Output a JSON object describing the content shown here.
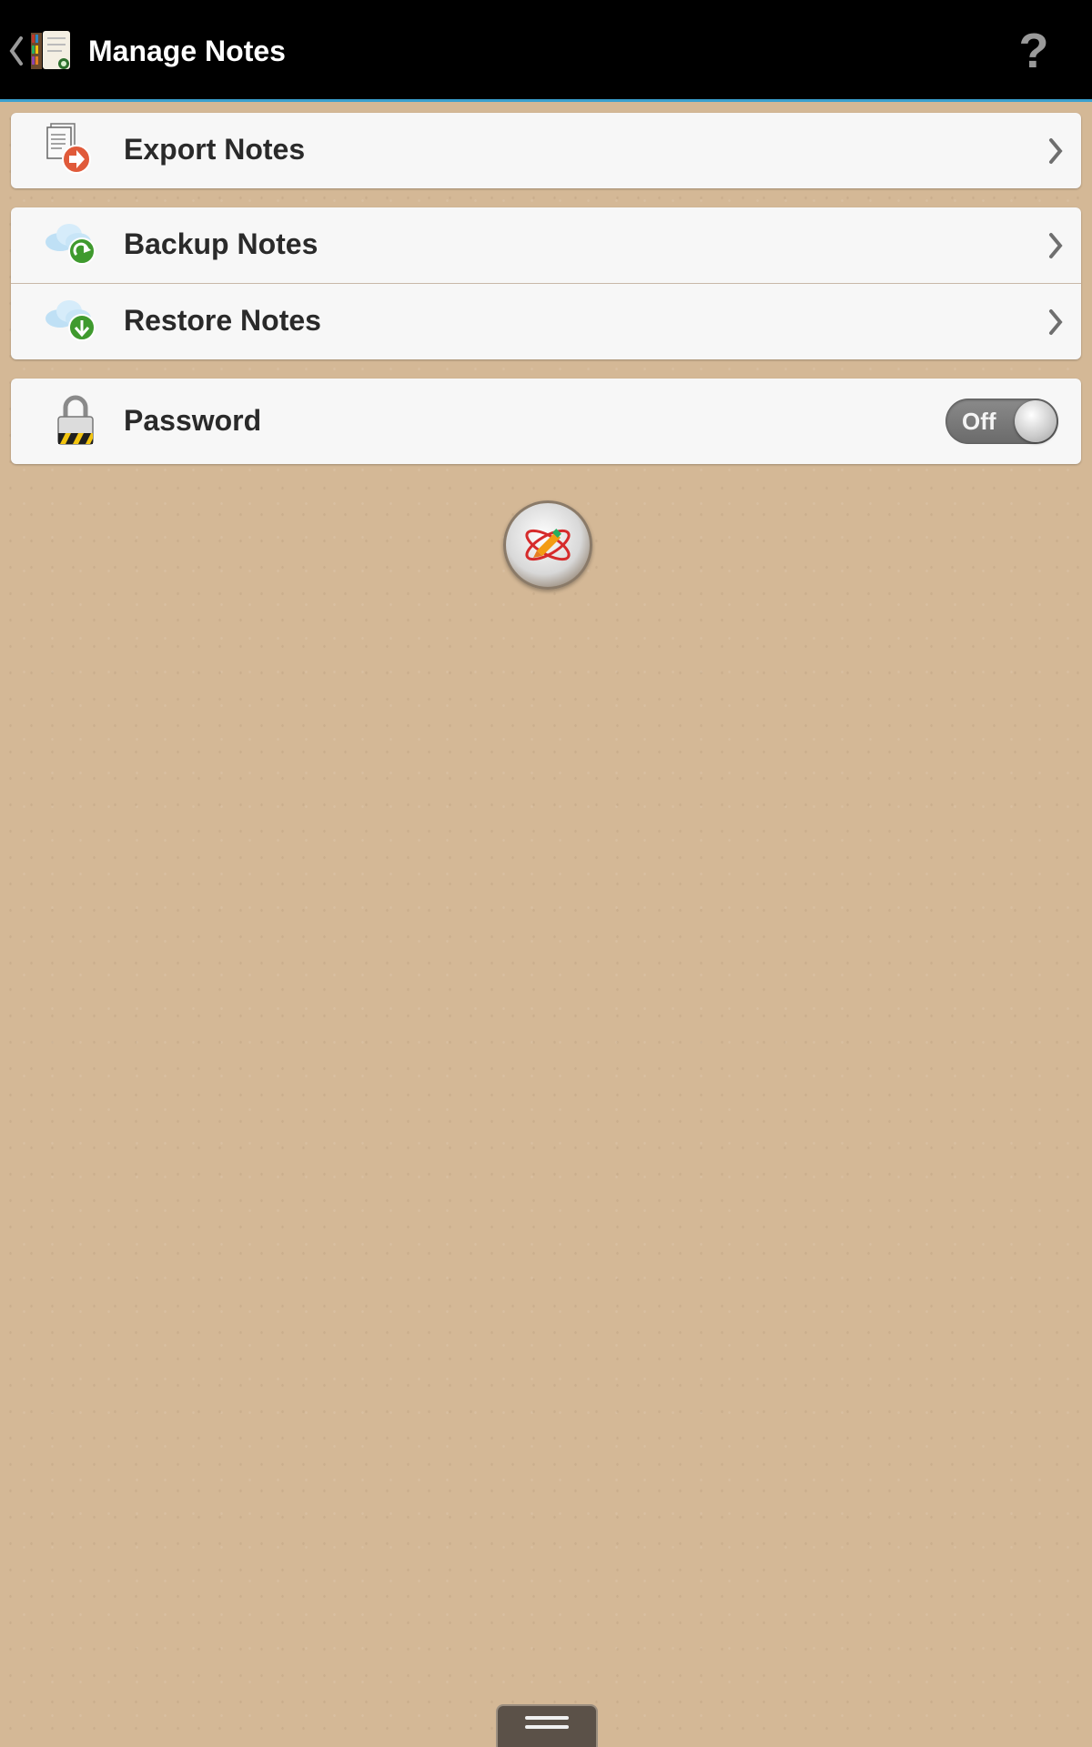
{
  "header": {
    "title": "Manage Notes",
    "help_label": "?"
  },
  "groups": [
    {
      "items": [
        {
          "label": "Export Notes",
          "icon": "export-document-icon"
        }
      ]
    },
    {
      "items": [
        {
          "label": "Backup Notes",
          "icon": "cloud-upload-icon"
        },
        {
          "label": "Restore Notes",
          "icon": "cloud-download-icon"
        }
      ]
    },
    {
      "items": [
        {
          "label": "Password",
          "icon": "padlock-icon",
          "toggle": {
            "label": "Off",
            "on": false
          }
        }
      ]
    }
  ],
  "colors": {
    "background": "#d4b896",
    "actionbar": "#000000",
    "accent": "#3aa0cf",
    "card": "#f7f7f7"
  }
}
